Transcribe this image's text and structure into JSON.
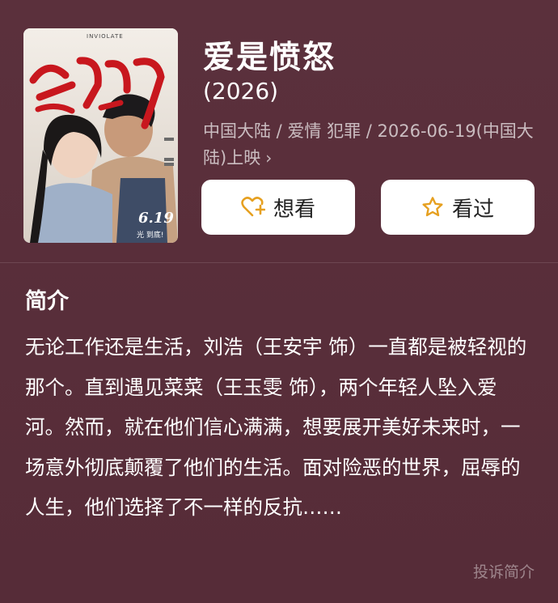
{
  "movie": {
    "title": "爱是愤怒",
    "year": "(2026)",
    "meta": "中国大陆 / 爱情 犯罪 / 2026-06-19(中国大陆)上映",
    "meta_chevron": "›",
    "poster": {
      "title_text": "爱是愤怒",
      "english_text": "INVIOLATE",
      "date_text": "6.19",
      "tagline": "光 到底!"
    }
  },
  "actions": {
    "want_label": "想看",
    "seen_label": "看过"
  },
  "intro": {
    "heading": "简介",
    "text": "无论工作还是生活，刘浩（王安宇 饰）一直都是被轻视的那个。直到遇见菜菜（王玉雯 饰），两个年轻人坠入爱河。然而，就在他们信心满满，想要展开美好未来时，一场意外彻底颠覆了他们的生活。面对险恶的世界，屈辱的人生，他们选择了不一样的反抗……",
    "report_label": "投诉简介"
  },
  "colors": {
    "background": "#5a2f3b",
    "button_bg": "#ffffff",
    "accent_icon": "#e6a020"
  }
}
